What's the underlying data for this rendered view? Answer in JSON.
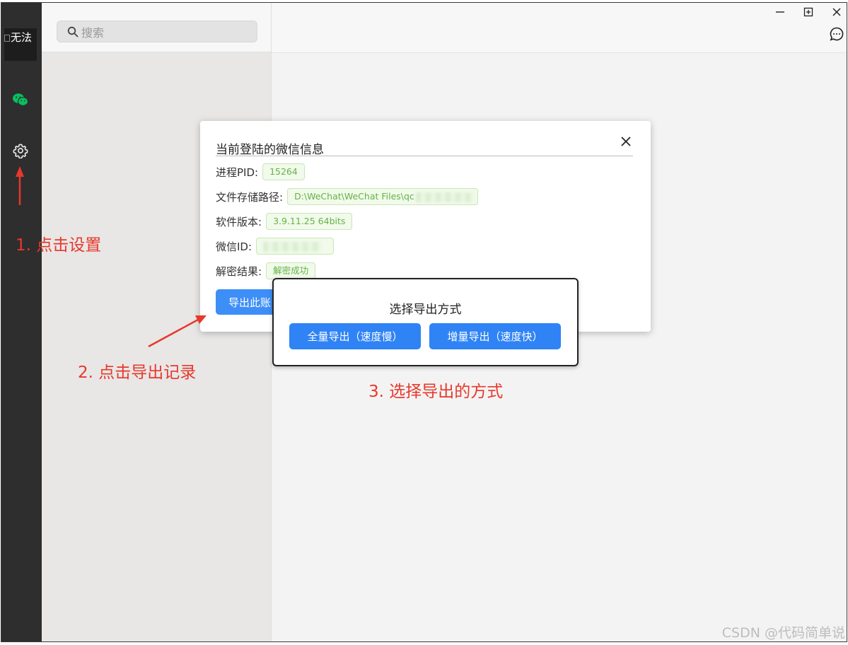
{
  "avatar": {
    "alt_text": "无法"
  },
  "search": {
    "placeholder": "搜索"
  },
  "dialog": {
    "title": "当前登陆的微信信息",
    "rows": [
      {
        "label": "进程PID:",
        "value": "15264"
      },
      {
        "label": "文件存储路径:",
        "value": "D:\\WeChat\\WeChat Files\\qc"
      },
      {
        "label": "软件版本:",
        "value": "3.9.11.25 64bits"
      },
      {
        "label": "微信ID:",
        "value": ""
      },
      {
        "label": "解密结果:",
        "value": "解密成功"
      }
    ],
    "export_button": "导出此账"
  },
  "popup": {
    "title": "选择导出方式",
    "full_export": "全量导出（速度慢）",
    "incremental_export": "增量导出（速度快）"
  },
  "annotations": {
    "step1": "1. 点击设置",
    "step2": "2. 点击导出记录",
    "step3": "3. 选择导出的方式"
  },
  "watermark": "CSDN @代码简单说",
  "colors": {
    "sidebar": "#2e2e2e",
    "wechat_green": "#07c160",
    "primary_button": "#2f83f5",
    "tag_green": "#63b344",
    "annotation_red": "#e8372b"
  },
  "icons": [
    "wechat-icon",
    "settings-gear-icon",
    "search-icon",
    "minimize-icon",
    "maximize-icon",
    "close-icon",
    "more-chat-icon"
  ]
}
